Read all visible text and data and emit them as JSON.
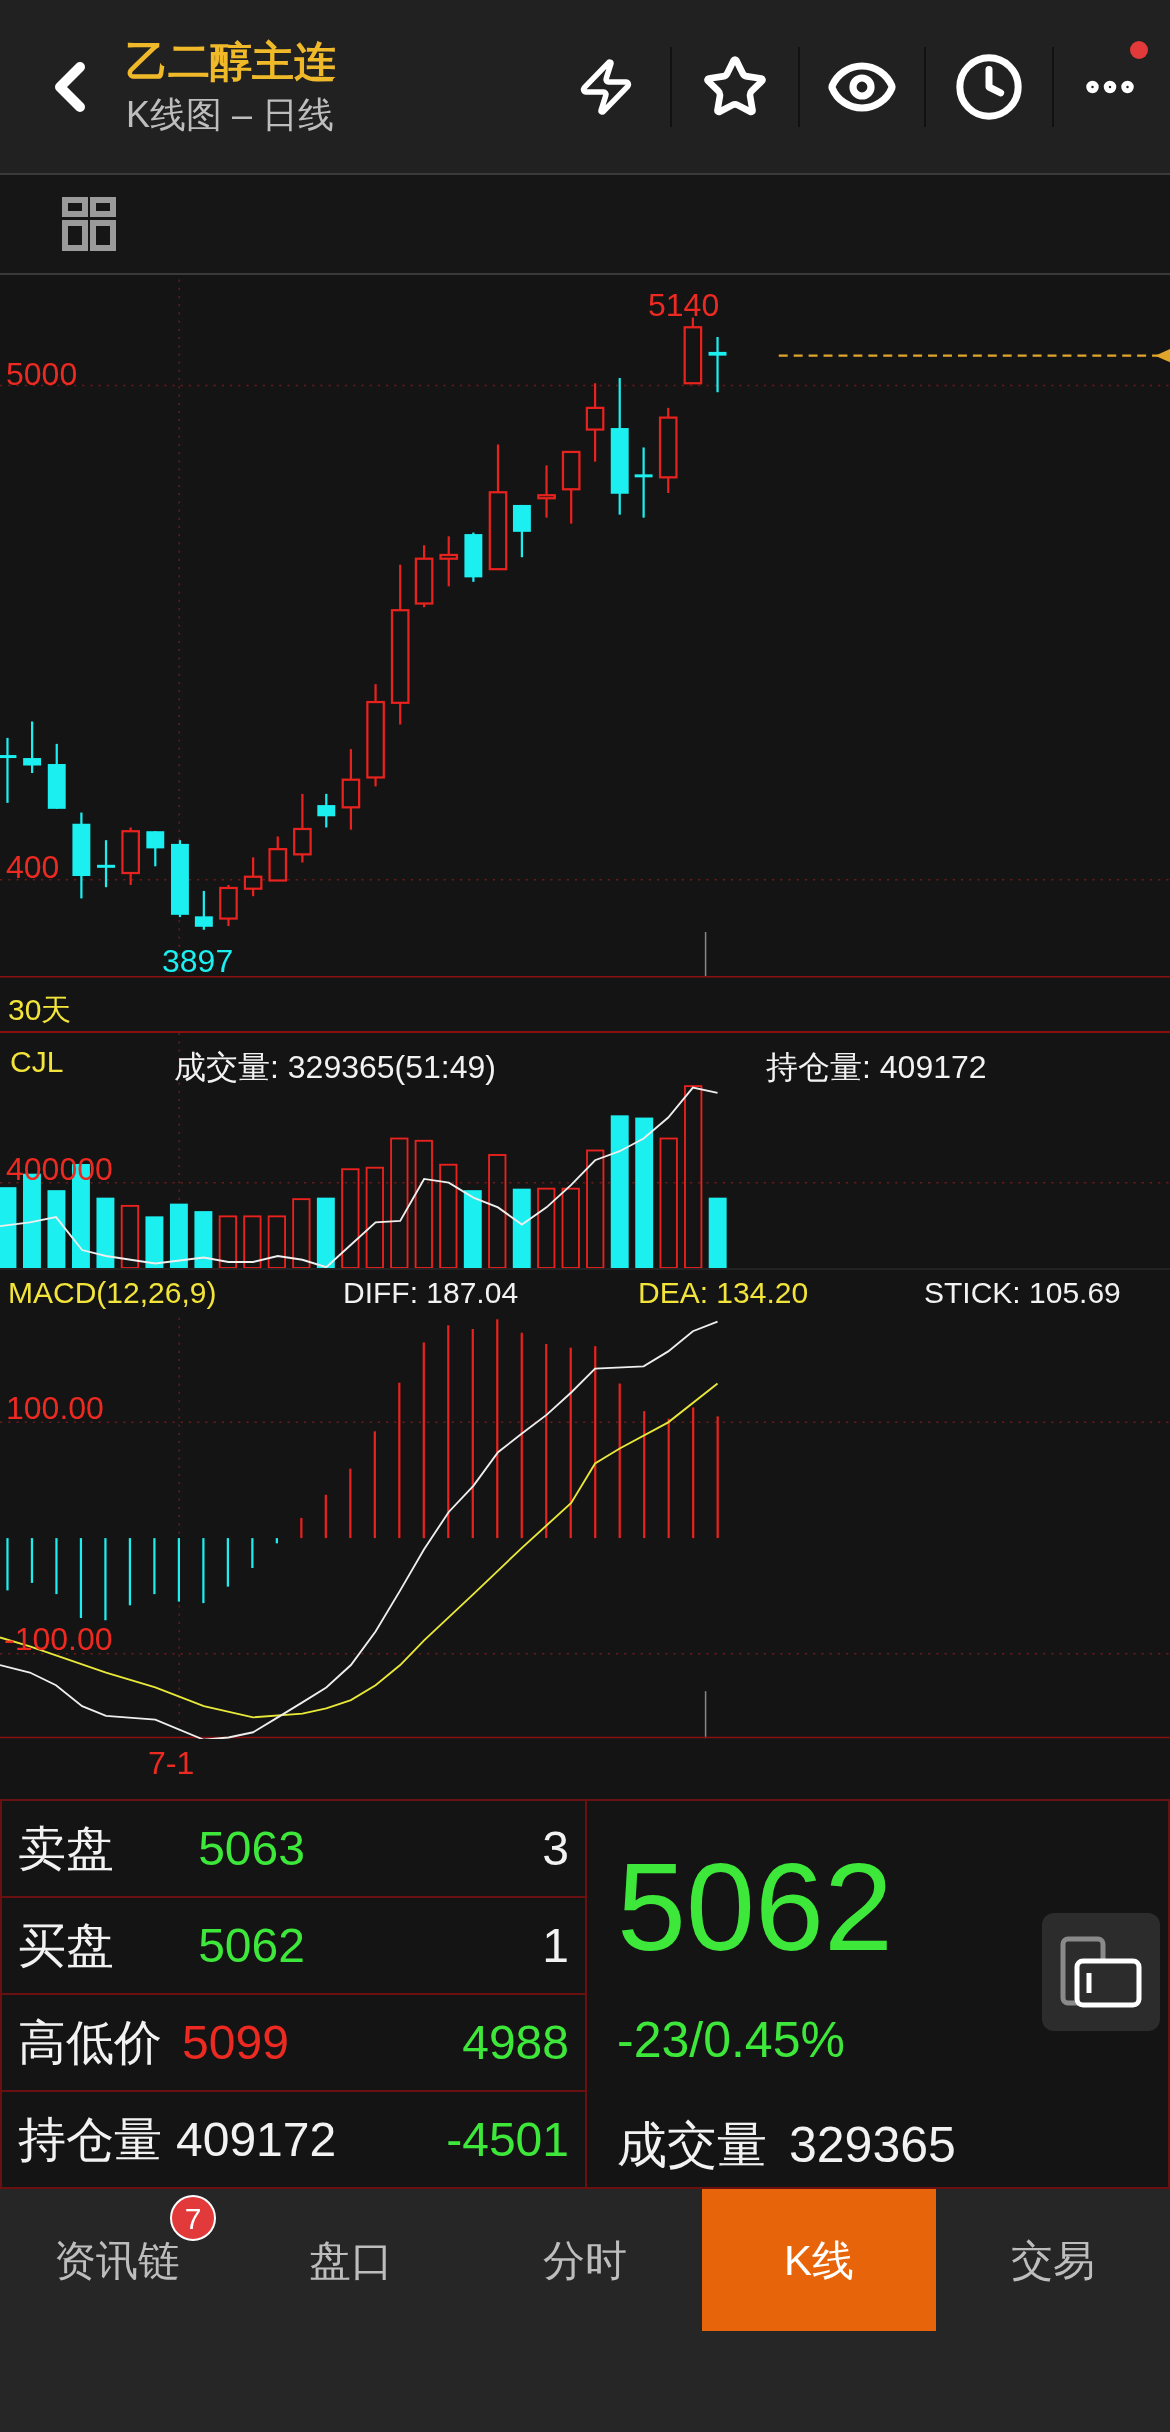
{
  "header": {
    "title": "乙二醇主连",
    "subtitle": "K线图 – 日线",
    "notification_dot": true
  },
  "price_chart": {
    "high_label": "5140",
    "y_labels": [
      "5000",
      "400"
    ],
    "low_label": "3897"
  },
  "period_label": "30天",
  "volume_panel": {
    "name": "CJL",
    "volume": "成交量: 329365(51:49)",
    "open_interest": "持仓量: 409172",
    "y_label": "400000"
  },
  "macd_panel": {
    "name": "MACD(12,26,9)",
    "diff": "DIFF: 187.04",
    "dea": "DEA: 134.20",
    "stick": "STICK: 105.69",
    "y_labels": [
      "100.00",
      "-100.00"
    ],
    "date_label": "7-1"
  },
  "quote": {
    "rows": [
      {
        "label": "卖盘",
        "cells": [
          {
            "text": "5063",
            "color": "#3de83a"
          },
          {
            "text": "3",
            "color": "#f2f2f2"
          }
        ]
      },
      {
        "label": "买盘",
        "cells": [
          {
            "text": "5062",
            "color": "#3de83a"
          },
          {
            "text": "1",
            "color": "#f2f2f2"
          }
        ]
      },
      {
        "label": "高低价",
        "cells": [
          {
            "text": "5099",
            "color": "#ec2a22"
          },
          {
            "text": "4988",
            "color": "#3de83a"
          }
        ]
      },
      {
        "label": "持仓量",
        "cells": [
          {
            "text": "409172",
            "color": "#f2f2f2"
          },
          {
            "text": "-4501",
            "color": "#3de83a"
          }
        ]
      }
    ],
    "last_price": "5062",
    "change": "-23/0.45%",
    "color": "#3de83a",
    "volume_label": "成交量",
    "volume": "329365"
  },
  "tabs": [
    {
      "label": "资讯链",
      "selected": false,
      "badge": "7"
    },
    {
      "label": "盘口",
      "selected": false
    },
    {
      "label": "分时",
      "selected": false
    },
    {
      "label": "K线",
      "selected": true
    },
    {
      "label": "交易",
      "selected": false
    }
  ]
}
